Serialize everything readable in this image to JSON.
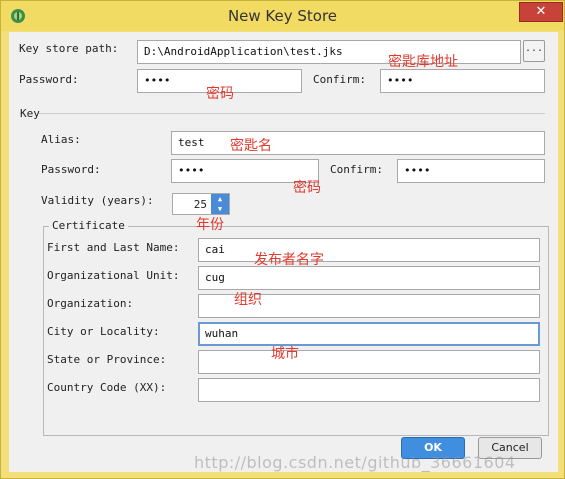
{
  "window": {
    "title": "New Key Store",
    "close_label": "✕"
  },
  "keystore": {
    "path_label": "Key store path:",
    "path_value": "D:\\AndroidApplication\\test.jks",
    "browse_label": "...",
    "password_label": "Password:",
    "password_value": "••••",
    "confirm_label": "Confirm:",
    "confirm_value": "••••"
  },
  "key": {
    "section_label": "Key",
    "alias_label": "Alias:",
    "alias_value": "test",
    "password_label": "Password:",
    "password_value": "••••",
    "confirm_label": "Confirm:",
    "confirm_value": "••••",
    "validity_label": "Validity (years):",
    "validity_value": "25"
  },
  "certificate": {
    "section_label": "Certificate",
    "first_last_label": "First and Last Name:",
    "first_last_value": "cai",
    "org_unit_label": "Organizational Unit:",
    "org_unit_value": "cug",
    "org_label": "Organization:",
    "org_value": "",
    "city_label": "City or Locality:",
    "city_value": "wuhan",
    "state_label": "State or Province:",
    "state_value": "",
    "country_label": "Country Code (XX):",
    "country_value": ""
  },
  "annotations": {
    "keystore_path": "密匙库地址",
    "keystore_password": "密码",
    "alias": "密匙名",
    "key_password": "密码",
    "validity": "年份",
    "first_last": "发布者名字",
    "organization": "组织",
    "city": "城市"
  },
  "buttons": {
    "ok": "OK",
    "cancel": "Cancel"
  },
  "watermark": "http://blog.csdn.net/github_36661604",
  "colors": {
    "window_frame": "#f2db63",
    "client_bg": "#f0f0f0",
    "accent": "#3f8ee0",
    "annotation_red": "#e03a2e",
    "close_red": "#c7433a"
  }
}
